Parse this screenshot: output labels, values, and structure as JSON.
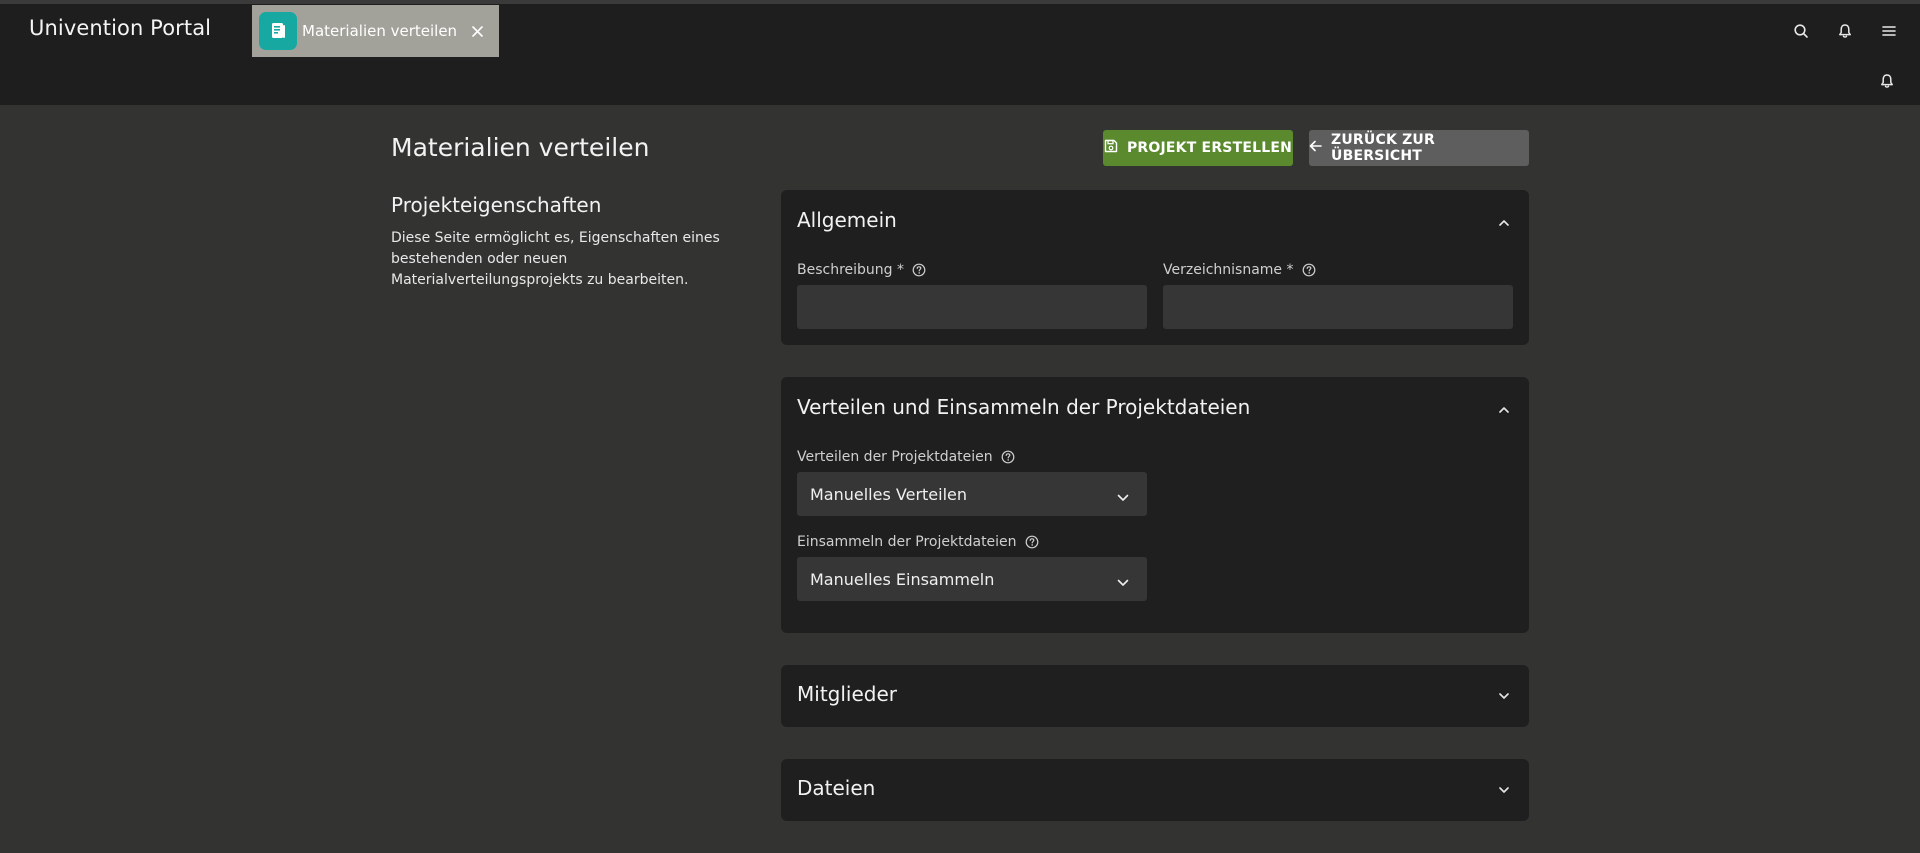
{
  "header": {
    "brand": "Univention Portal",
    "tab": {
      "label": "Materialien verteilen",
      "icon": "document-icon"
    },
    "icons": [
      "search-icon",
      "bell-icon",
      "menu-icon"
    ]
  },
  "subbar": {
    "icon": "bell-icon"
  },
  "page": {
    "title": "Materialien verteilen",
    "create_button": "PROJEKT ERSTELLEN",
    "back_button": "ZURÜCK ZUR ÜBERSICHT"
  },
  "sidebar": {
    "heading": "Projekteigenschaften",
    "description": "Diese Seite ermöglicht es, Eigenschaften eines bestehenden oder neuen Materialverteilungsprojekts zu bearbeiten."
  },
  "sections": {
    "general": {
      "title": "Allgemein",
      "description_label": "Beschreibung *",
      "description_value": "",
      "dirname_label": "Verzeichnisname *",
      "dirname_value": ""
    },
    "distribute": {
      "title": "Verteilen und Einsammeln der Projektdateien",
      "distribute_label": "Verteilen der Projektdateien",
      "distribute_value": "Manuelles Verteilen",
      "collect_label": "Einsammeln der Projektdateien",
      "collect_value": "Manuelles Einsammeln"
    },
    "members": {
      "title": "Mitglieder"
    },
    "files": {
      "title": "Dateien"
    }
  }
}
